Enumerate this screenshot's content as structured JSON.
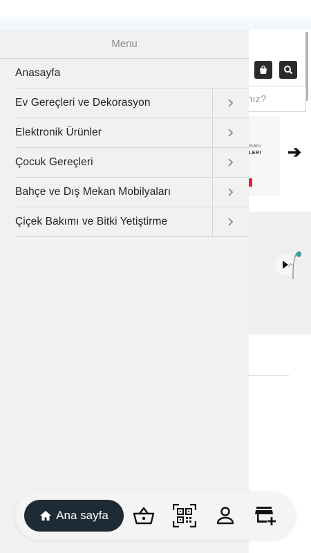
{
  "background": {
    "search_placeholder": "nız?",
    "card_line1": "manı",
    "card_line2": "LERI"
  },
  "drawer": {
    "title": "Menu",
    "items": [
      {
        "label": "Anasayfa",
        "has_children": false
      },
      {
        "label": "Ev Gereçleri ve Dekorasyon",
        "has_children": true
      },
      {
        "label": "Elektronik Ürünler",
        "has_children": true
      },
      {
        "label": "Çocuk Gereçleri",
        "has_children": true
      },
      {
        "label": "Bahçe ve Dış Mekan Mobilyaları",
        "has_children": true
      },
      {
        "label": "Çiçek Bakımı ve Bitki Yetiştirme",
        "has_children": true
      }
    ]
  },
  "bottom_nav": {
    "home_label": "Ana sayfa",
    "icons": [
      "basket-icon",
      "qr-code-icon",
      "user-icon",
      "add-store-icon"
    ],
    "home_bg": "#1e2b35"
  }
}
